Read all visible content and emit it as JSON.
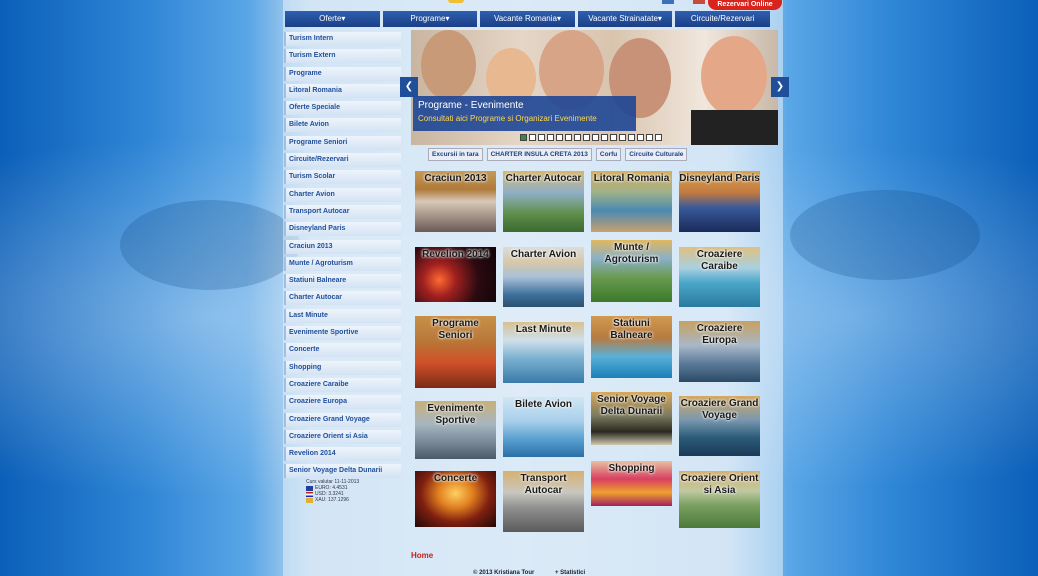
{
  "topbar": {
    "online_label": "Rezervari Online"
  },
  "nav": [
    {
      "label": "Oferte▾"
    },
    {
      "label": "Programe▾"
    },
    {
      "label": "Vacante Romania▾"
    },
    {
      "label": "Vacante Strainatate▾"
    },
    {
      "label": "Circuite/Rezervari"
    }
  ],
  "sidebar": [
    "Turism Intern",
    "Turism Extern",
    "Programe",
    "Litoral Romania",
    "Oferte Speciale",
    "Bilete Avion",
    "Programe Seniori",
    "Circuite/Rezervari",
    "Turism Scolar",
    "Charter Avion",
    "Transport Autocar",
    "Disneyland Paris",
    "Craciun 2013",
    "Munte / Agroturism",
    "Statiuni Balneare",
    "Charter Autocar",
    "Last Minute",
    "Evenimente Sportive",
    "Concerte",
    "Shopping",
    "Croaziere Caraibe",
    "Croaziere Europa",
    "Croaziere Grand Voyage",
    "Croaziere Orient si Asia",
    "Revelion 2014",
    "Senior Voyage Delta Dunarii"
  ],
  "currency": {
    "title": "Curs valutar 11-11-2013",
    "euro": "EURO: 4.4531",
    "usd": "USD: 3.3241",
    "xau": "XAU: 137.1296"
  },
  "banner": {
    "title": "Programe - Evenimente",
    "subtitle": "Consultati aici Programe si Organizari Evenimente",
    "prev": "❮",
    "next": "❯"
  },
  "subtabs": [
    "Excursii in tara",
    "CHARTER INSULA CRETA 2013",
    "Corfu",
    "Circuite Culturale"
  ],
  "tiles": [
    {
      "label": "Craciun 2013",
      "bg": "linear-gradient(#c49a58 0%,#b07a3a 30%,#d8c8b8 50%,#6b5a55 100%)"
    },
    {
      "label": "Charter Autocar",
      "bg": "linear-gradient(#d9b56a 0%,#8fb0c8 35%,#5f8f4a 70%,#3a6a30 100%)"
    },
    {
      "label": "Litoral Romania",
      "bg": "linear-gradient(#d6ad5a 0%,#9fb08a 35%,#4a8ab0 65%,#c8a070 100%)"
    },
    {
      "label": "Disneyland Paris",
      "bg": "linear-gradient(#d4a250 0%,#c47a40 35%,#3a5a9a 60%,#1a2a5a 100%)"
    },
    {
      "label": "Revelion 2014",
      "bg": "radial-gradient(circle at 30% 60%,#ff6a30 0%,#a02020 25%,#2a0a10 60%,#100408 100%)"
    },
    {
      "label": "Charter Avion",
      "bg": "linear-gradient(#dcdcdc 0%,#d7c9a7 25%,#a8c0d8 50%,#3d6f9a 80%,#2a5070 100%)"
    },
    {
      "label": "Munte / Agroturism",
      "bg": "linear-gradient(#e0b860 0%,#8ab0c8 30%,#6a9a50 60%,#3a7a2a 100%)"
    },
    {
      "label": "Croaziere Caraibe",
      "bg": "linear-gradient(#dfc080 0%,#a8d0e0 35%,#4aa6c8 60%,#2a7aa0 100%)"
    },
    {
      "label": "Programe Seniori",
      "bg": "linear-gradient(#c89048 0%,#b87838 35%,#d05028 65%,#7a2a18 100%)"
    },
    {
      "label": "Last Minute",
      "bg": "linear-gradient(#d8c090 0%,#cfe0ea 30%,#7ab0d0 60%,#3a7aa8 100%)"
    },
    {
      "label": "Statiuni Balneare",
      "bg": "linear-gradient(#d09a50 0%,#b87a40 35%,#5ab0d8 65%,#1a80b8 100%)"
    },
    {
      "label": "Croaziere Europa",
      "bg": "linear-gradient(#c8a060 0%,#a8b8c8 40%,#5a7a98 70%,#2a4a68 100%)"
    },
    {
      "label": "Evenimente Sportive",
      "bg": "linear-gradient(#c8b07a 0%,#a6b6c0 40%,#7a8a98 70%,#4a5a68 100%)"
    },
    {
      "label": "Bilete Avion",
      "bg": "linear-gradient(#cfe6f4 0%,#a8d0ea 40%,#5aa0d0 70%,#2a70a8 100%)"
    },
    {
      "label": "Senior Voyage Delta Dunarii",
      "bg": "linear-gradient(#d8a858 0%,#7a7a60 45%,#2a2a20 75%,#d0c8b0 100%)"
    },
    {
      "label": "Croaziere Grand Voyage",
      "bg": "linear-gradient(#d4a860 0%,#7a98b0 40%,#2a5a78 70%,#1a3a58 100%)"
    },
    {
      "label": "Concerte",
      "bg": "radial-gradient(ellipse at 50% 40%,#ffd060 0%,#e08020 30%,#802010 60%,#200808 100%)"
    },
    {
      "label": "Transport Autocar",
      "bg": "linear-gradient(#d8b070 0%,#c8c8c0 35%,#909090 60%,#5a5a5a 100%)"
    },
    {
      "label": "Shopping",
      "bg": "linear-gradient(#e8c0a0 0%,#d84060 40%,#f0a030 70%,#a02060 100%)"
    },
    {
      "label": "Croaziere Orient si Asia",
      "bg": "linear-gradient(#d8b070 0%,#c0c8a0 35%,#7aa060 60%,#4a7a3a 100%)"
    }
  ],
  "home_label": "Home",
  "footer": {
    "copyright": "© 2013 Kristiana Tour",
    "stats": "+ Statistici"
  }
}
